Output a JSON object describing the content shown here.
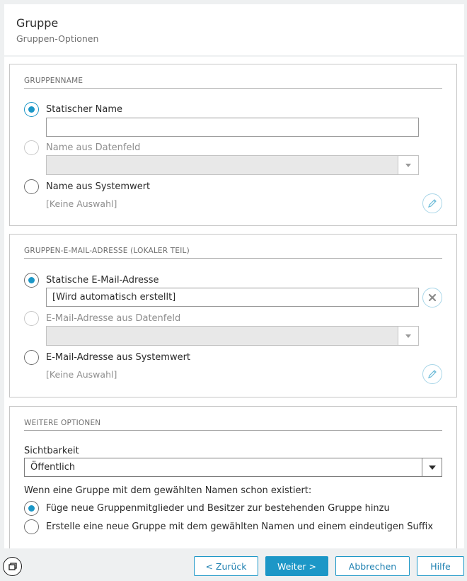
{
  "header": {
    "title": "Gruppe",
    "subtitle": "Gruppen-Optionen"
  },
  "sections": {
    "gruppenname": {
      "heading": "GRUPPENNAME",
      "opt_static": "Statischer Name",
      "static_value": "",
      "opt_datafield": "Name aus Datenfeld",
      "opt_system": "Name aus Systemwert",
      "system_value": "[Keine Auswahl]"
    },
    "email": {
      "heading": "GRUPPEN-E-MAIL-ADRESSE (LOKALER TEIL)",
      "opt_static": "Statische E-Mail-Adresse",
      "static_value": "[Wird automatisch erstellt]",
      "opt_datafield": "E-Mail-Adresse aus Datenfeld",
      "opt_system": "E-Mail-Adresse aus Systemwert",
      "system_value": "[Keine Auswahl]"
    },
    "weitere": {
      "heading": "WEITERE OPTIONEN",
      "visibility_label": "Sichtbarkeit",
      "visibility_value": "Öffentlich",
      "exists_text": "Wenn eine Gruppe mit dem gewählten Namen schon existiert:",
      "opt_add": "Füge neue Gruppenmitglieder und Besitzer zur bestehenden Gruppe hinzu",
      "opt_create": "Erstelle eine neue Gruppe mit dem gewählten Namen und einem eindeutigen Suffix"
    }
  },
  "footer": {
    "back": "< Zurück",
    "next": "Weiter >",
    "cancel": "Abbrechen",
    "help": "Hilfe"
  },
  "colors": {
    "accent": "#1c97c7"
  }
}
